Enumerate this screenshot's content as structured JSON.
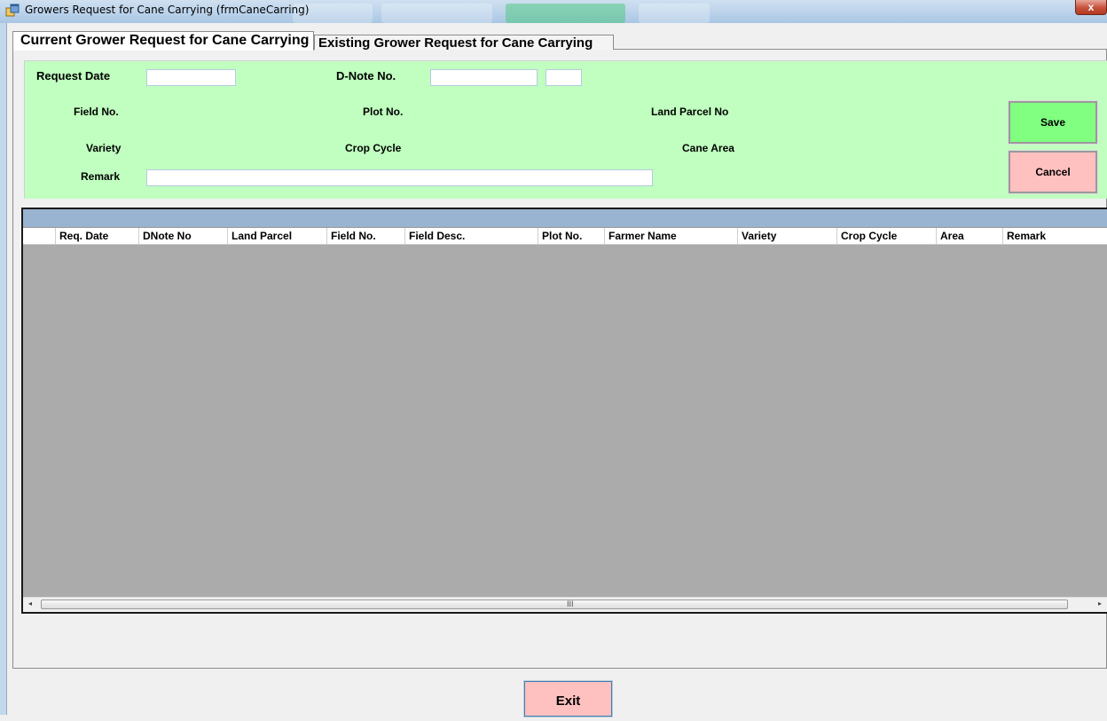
{
  "window": {
    "title": "Growers Request for Cane Carrying (frmCaneCarring)",
    "close_label": "x",
    "icon": "app-form-icon"
  },
  "tabs": [
    {
      "label": "Current Grower Request for Cane Carrying",
      "selected": true
    },
    {
      "label": "Existing Grower Request for Cane Carrying",
      "selected": false
    }
  ],
  "form": {
    "request_date_label": "Request Date",
    "request_date_value": "",
    "dnote_label": "D-Note No.",
    "dnote_value": "",
    "dnote_suffix_value": "",
    "field_no_label": "Field No.",
    "plot_no_label": "Plot No.",
    "land_parcel_label": "Land Parcel No",
    "variety_label": "Variety",
    "crop_cycle_label": "Crop Cycle",
    "cane_area_label": "Cane Area",
    "remark_label": "Remark",
    "remark_value": ""
  },
  "buttons": {
    "save": "Save",
    "cancel": "Cancel",
    "exit": "Exit"
  },
  "grid": {
    "columns": [
      "Req. Date",
      "DNote No",
      "Land Parcel",
      "Field No.",
      "Field Desc.",
      "Plot No.",
      "Farmer Name",
      "Variety",
      "Crop Cycle",
      "Area",
      "Remark"
    ],
    "rows": [],
    "scroll_grip": "III",
    "scroll_left": "◂",
    "scroll_right": "▸"
  },
  "colors": {
    "form_background": "#c0ffc0",
    "save_button": "#80ff80",
    "cancel_button": "#ffc0c0",
    "exit_button": "#ffc0c0",
    "grid_caption": "#99b4d1",
    "grid_body": "#ababab"
  }
}
